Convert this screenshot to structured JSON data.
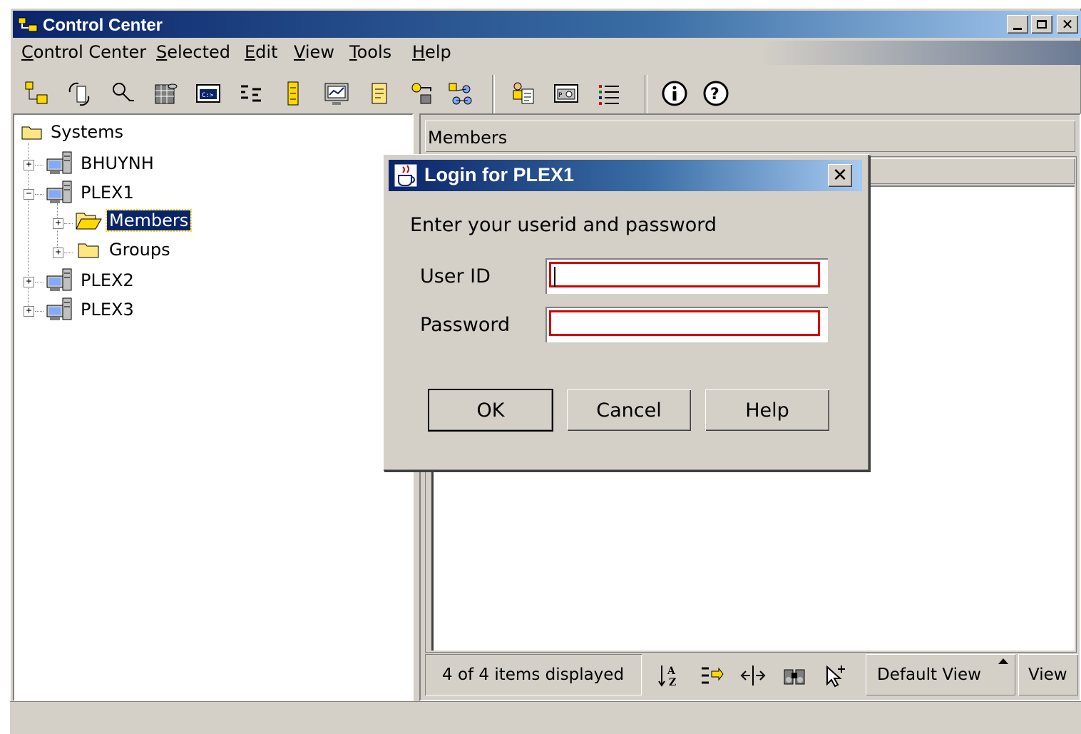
{
  "window": {
    "title": "Control Center"
  },
  "menubar": {
    "items": [
      {
        "label": "Control Center",
        "accel": "C"
      },
      {
        "label": "Selected",
        "accel": "S"
      },
      {
        "label": "Edit",
        "accel": "E"
      },
      {
        "label": "View",
        "accel": "V"
      },
      {
        "label": "Tools",
        "accel": "T"
      },
      {
        "label": "Help",
        "accel": "H"
      }
    ]
  },
  "toolbar": {
    "icons": [
      "systems-icon",
      "replication-icon",
      "search-icon",
      "database-icon",
      "command-icon",
      "script-icon",
      "log-icon",
      "monitor-icon",
      "journal-icon",
      "keys-icon",
      "network-icon",
      "users-icon",
      "settings-icon",
      "list-icon",
      "info-icon",
      "help-icon"
    ]
  },
  "tree": {
    "root": "Systems",
    "nodes": [
      {
        "label": "BHUYNH",
        "expanded": false
      },
      {
        "label": "PLEX1",
        "expanded": true,
        "children": [
          {
            "label": "Members",
            "selected": true
          },
          {
            "label": "Groups"
          }
        ]
      },
      {
        "label": "PLEX2",
        "expanded": false
      },
      {
        "label": "PLEX3",
        "expanded": false
      }
    ]
  },
  "details": {
    "header": "Members",
    "status": "4 of 4 items displayed",
    "view_selector": "Default View",
    "view_button": "View"
  },
  "dialog": {
    "title": "Login for PLEX1",
    "prompt": "Enter your userid and password",
    "userid_label": "User ID",
    "userid_value": "",
    "password_label": "Password",
    "password_value": "",
    "ok": "OK",
    "cancel": "Cancel",
    "help": "Help"
  }
}
